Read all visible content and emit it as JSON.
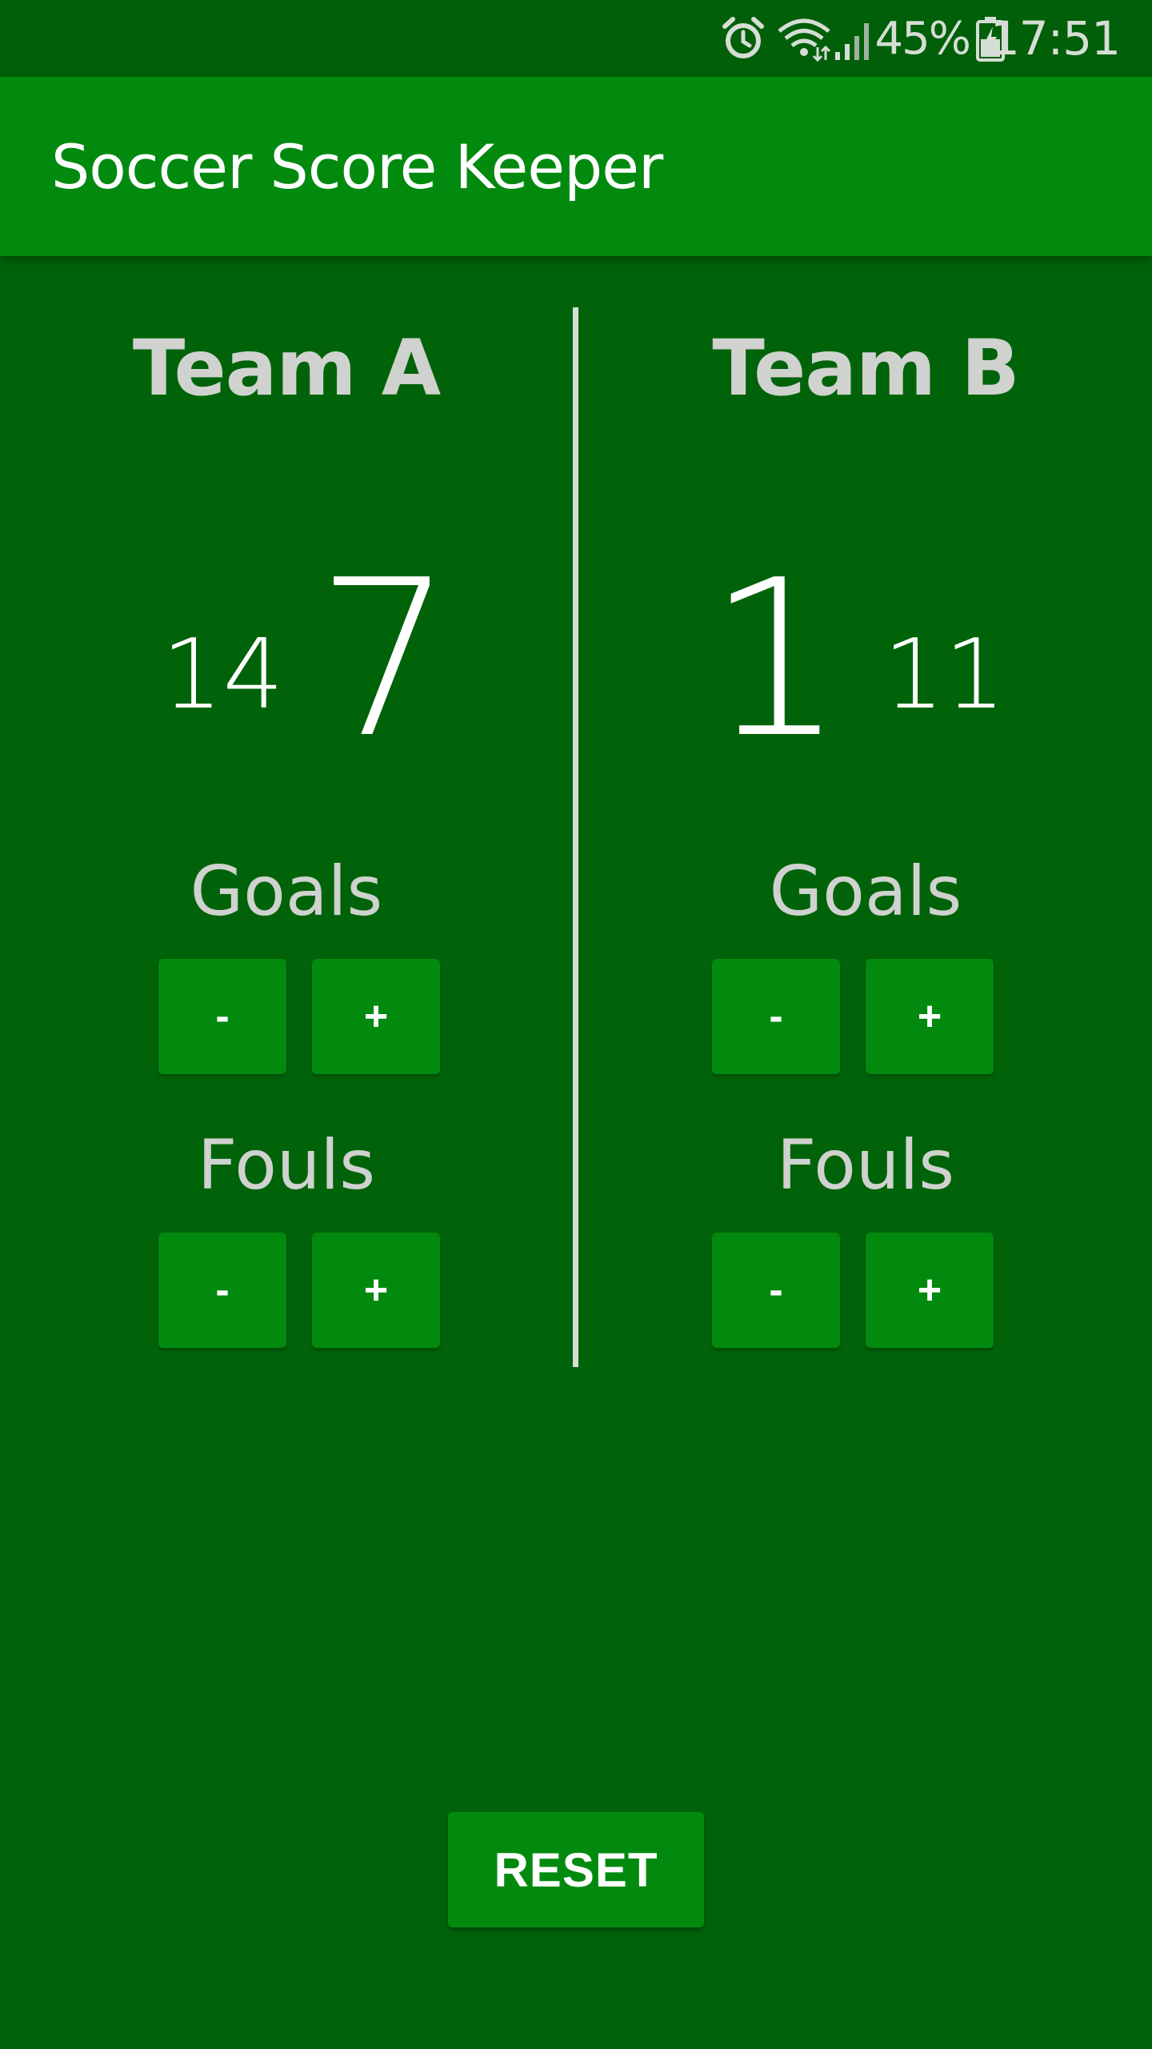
{
  "status_bar": {
    "battery_percent": "45%",
    "time": "17:51",
    "icons": [
      "alarm-icon",
      "wifi-icon",
      "signal-icon",
      "battery-charging-icon"
    ]
  },
  "app_bar": {
    "title": "Soccer Score Keeper"
  },
  "team_a": {
    "name": "Team A",
    "goals": "7",
    "fouls": "14",
    "goals_label": "Goals",
    "fouls_label": "Fouls",
    "minus_label": "-",
    "plus_label": "+"
  },
  "team_b": {
    "name": "Team B",
    "goals": "1",
    "fouls": "11",
    "goals_label": "Goals",
    "fouls_label": "Fouls",
    "minus_label": "-",
    "plus_label": "+"
  },
  "reset_label": "RESET",
  "colors": {
    "background": "#006309",
    "app_bar": "#028a0f",
    "button": "#028a0f",
    "label": "#cfd2cf"
  }
}
